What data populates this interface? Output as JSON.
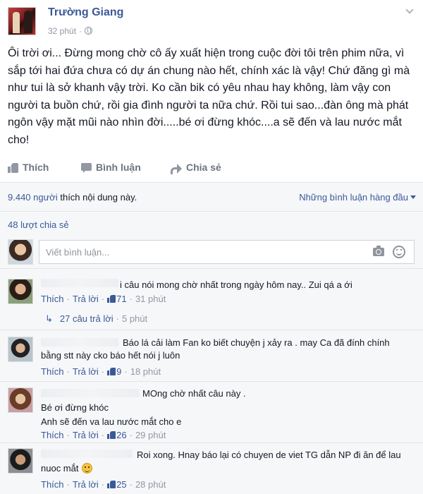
{
  "post": {
    "author": "Trường Giang",
    "time": "32 phút",
    "dot": "·",
    "text": "Ôi trời ơi... Đừng mong chờ cô ấy xuất hiện trong cuộc đời tôi trên phim nữa, vì sắp tới hai đứa chưa có dự án chung nào hết, chính xác là vậy! Chứ đăng gì mà như tui là sở khanh vậy trời. Ko cần bik có yêu nhau hay không, làm vậy con người ta buồn chứ, rồi gia đình người ta nữa chứ. Rồi tui sao...đàn ông mà phát ngôn vậy mặt mũi nào nhìn đời.....bé ơi đừng khóc....a sẽ đến và lau nước mắt cho!"
  },
  "actions": {
    "like": "Thích",
    "comment": "Bình luận",
    "share": "Chia sẻ"
  },
  "ufi": {
    "likes_count": "9.440 người",
    "likes_suffix": " thích nội dung này.",
    "top_comments": "Những bình luận hàng đầu",
    "shares": "48 lượt chia sẻ",
    "composer_placeholder": "Viết bình luận..."
  },
  "comments": [
    {
      "text": "i câu nói mong chờ nhất trong ngày hôm nay.. Zui qá a ới",
      "like": "Thích",
      "reply": "Trả lời",
      "likes": "71",
      "time": "31 phút",
      "replies": {
        "label": "27 câu trả lời",
        "time": "5 phút"
      }
    },
    {
      "text": "Báo lá cải làm Fan ko biết chuyện j xảy ra . may Ca đã đính chính bằng stt này cko báo hết nói j luôn",
      "like": "Thích",
      "reply": "Trả lời",
      "likes": "9",
      "time": "18 phút"
    },
    {
      "line1": "MOng chờ nhất câu này .",
      "line2": "Bé ơi đừng khóc",
      "line3": "Anh sẽ đến va lau nước mắt cho e",
      "like": "Thích",
      "reply": "Trả lời",
      "likes": "26",
      "time": "29 phút"
    },
    {
      "text": "Roi xong. Hnay báo lại có chuyen de viet TG dẫn NP đi ăn để lau nuoc mắt",
      "like": "Thích",
      "reply": "Trả lời",
      "likes": "25",
      "time": "28 phút"
    }
  ],
  "meta_sep": "·"
}
